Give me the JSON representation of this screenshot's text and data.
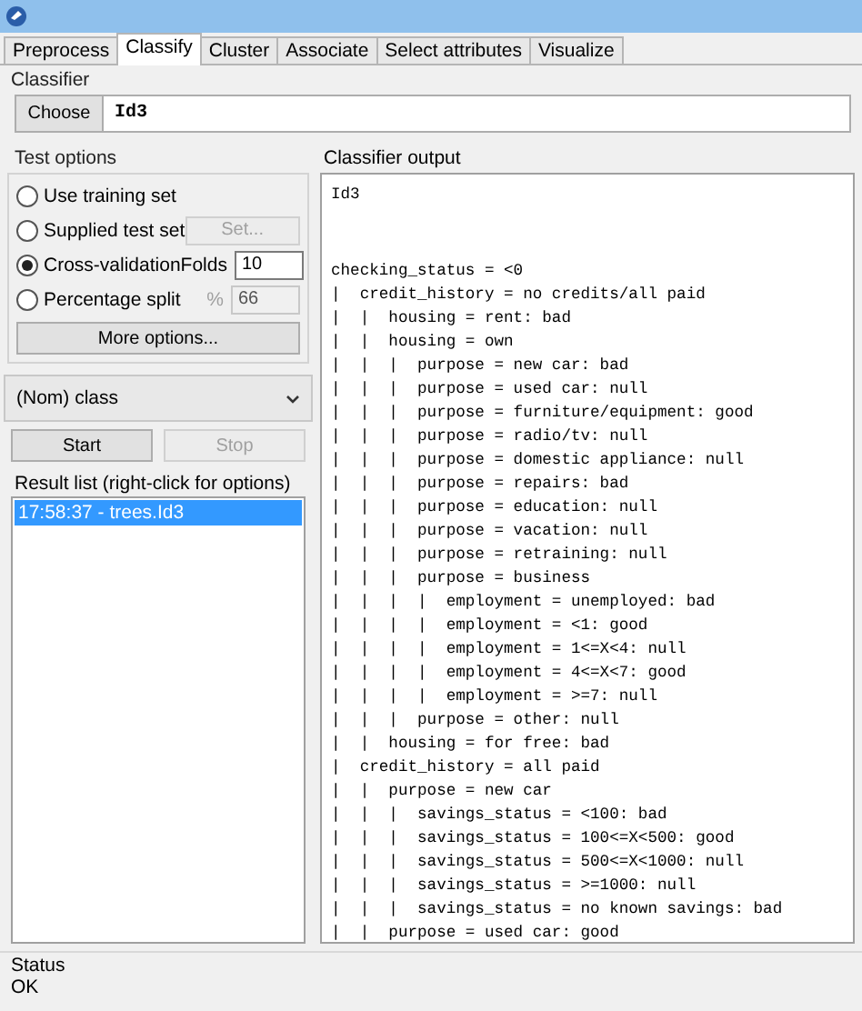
{
  "tabs": [
    {
      "label": "Preprocess",
      "selected": false
    },
    {
      "label": "Classify",
      "selected": true
    },
    {
      "label": "Cluster",
      "selected": false
    },
    {
      "label": "Associate",
      "selected": false
    },
    {
      "label": "Select attributes",
      "selected": false
    },
    {
      "label": "Visualize",
      "selected": false
    }
  ],
  "classifier": {
    "title": "Classifier",
    "button": "Choose",
    "value": "Id3"
  },
  "test_options": {
    "title": "Test options",
    "options": [
      {
        "label": "Use training set",
        "selected": false
      },
      {
        "label": "Supplied test set",
        "selected": false,
        "control": {
          "kind": "button",
          "text": "Set...",
          "disabled": true
        }
      },
      {
        "label": "Cross-validation",
        "selected": true,
        "control": {
          "kind": "field",
          "label": "Folds",
          "value": "10",
          "disabled": false
        }
      },
      {
        "label": "Percentage split",
        "selected": false,
        "control": {
          "kind": "field",
          "label": "%",
          "value": "66",
          "disabled": true
        }
      }
    ],
    "more_button": "More options..."
  },
  "class_dropdown": {
    "value": "(Nom) class"
  },
  "run_buttons": [
    {
      "label": "Start",
      "disabled": false
    },
    {
      "label": "Stop",
      "disabled": true
    }
  ],
  "result_list": {
    "title": "Result list (right-click for options)",
    "items": [
      {
        "label": "17:58:37 - trees.Id3",
        "selected": true
      }
    ]
  },
  "output": {
    "title": "Classifier output",
    "header": "Id3",
    "lines": [
      "checking_status = <0",
      "|  credit_history = no credits/all paid",
      "|  |  housing = rent: bad",
      "|  |  housing = own",
      "|  |  |  purpose = new car: bad",
      "|  |  |  purpose = used car: null",
      "|  |  |  purpose = furniture/equipment: good",
      "|  |  |  purpose = radio/tv: null",
      "|  |  |  purpose = domestic appliance: null",
      "|  |  |  purpose = repairs: bad",
      "|  |  |  purpose = education: null",
      "|  |  |  purpose = vacation: null",
      "|  |  |  purpose = retraining: null",
      "|  |  |  purpose = business",
      "|  |  |  |  employment = unemployed: bad",
      "|  |  |  |  employment = <1: good",
      "|  |  |  |  employment = 1<=X<4: null",
      "|  |  |  |  employment = 4<=X<7: good",
      "|  |  |  |  employment = >=7: null",
      "|  |  |  purpose = other: null",
      "|  |  housing = for free: bad",
      "|  credit_history = all paid",
      "|  |  purpose = new car",
      "|  |  |  savings_status = <100: bad",
      "|  |  |  savings_status = 100<=X<500: good",
      "|  |  |  savings_status = 500<=X<1000: null",
      "|  |  |  savings_status = >=1000: null",
      "|  |  |  savings_status = no known savings: bad",
      "|  |  purpose = used car: good"
    ]
  },
  "status": {
    "title": "Status",
    "text": "OK"
  }
}
